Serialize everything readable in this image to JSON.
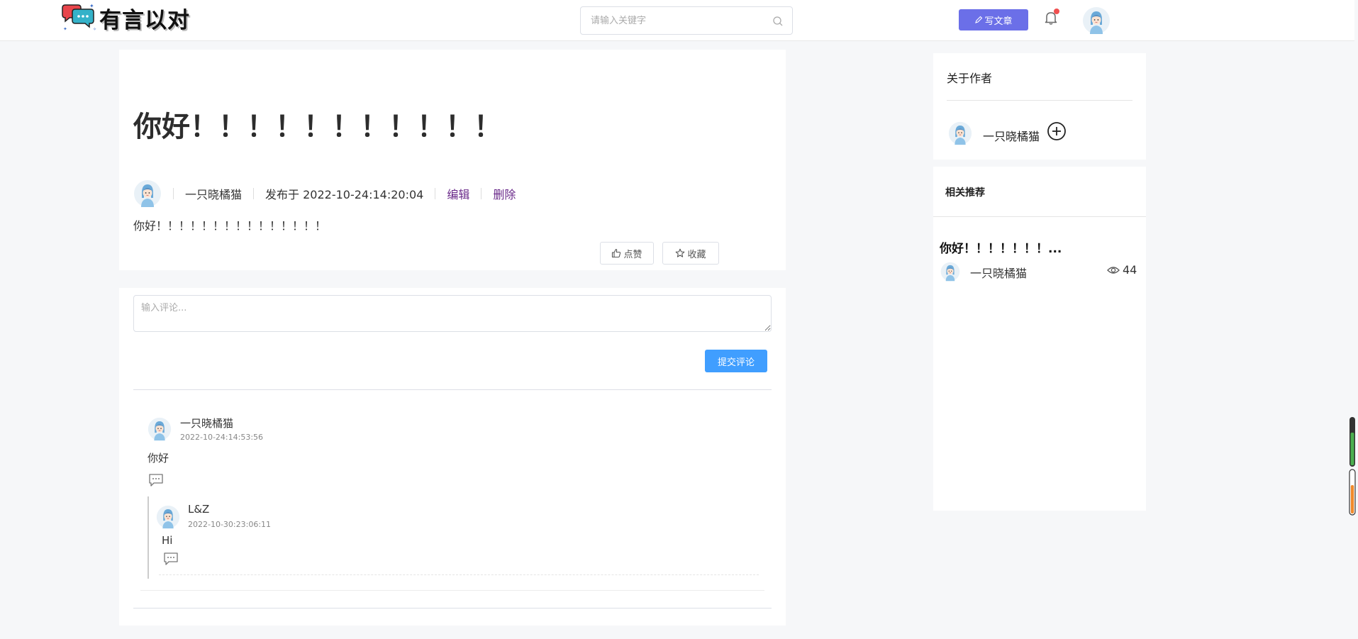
{
  "header": {
    "logo_text": "有言以对",
    "search_placeholder": "请输入关键字",
    "write_button": "写文章",
    "has_notification": true
  },
  "article": {
    "title": "你好！！！！！！！！！！！",
    "author": "一只晓橘猫",
    "published": "发布于 2022-10-24:14:20:04",
    "edit_label": "编辑",
    "delete_label": "删除",
    "body": "你好！！！！！！！！！！！！！！！",
    "like_label": "点赞",
    "favorite_label": "收藏"
  },
  "comments": {
    "input_placeholder": "输入评论...",
    "submit_label": "提交评论",
    "items": [
      {
        "author": "一只晓橘猫",
        "time": "2022-10-24:14:53:56",
        "text": "你好",
        "replies": [
          {
            "author": "L&Z",
            "time": "2022-10-30:23:06:11",
            "text": "Hi"
          }
        ]
      }
    ]
  },
  "sidebar": {
    "about_title": "关于作者",
    "author_name": "一只晓橘猫",
    "recommend_title": "相关推荐",
    "recommend_items": [
      {
        "title": "你好！！！！！！！...",
        "author": "一只晓橘猫",
        "views": "44"
      }
    ]
  },
  "colors": {
    "write_button": "#6b6fe8",
    "submit_button": "#409eff",
    "link": "#6a2a8a",
    "notification_dot": "#f05050"
  },
  "icons": [
    "chat-bubbles-logo-icon",
    "search-icon",
    "pen-icon",
    "bell-icon",
    "avatar",
    "thumb-up-icon",
    "star-icon",
    "comment-icon",
    "plus-circle-icon",
    "eye-icon"
  ]
}
